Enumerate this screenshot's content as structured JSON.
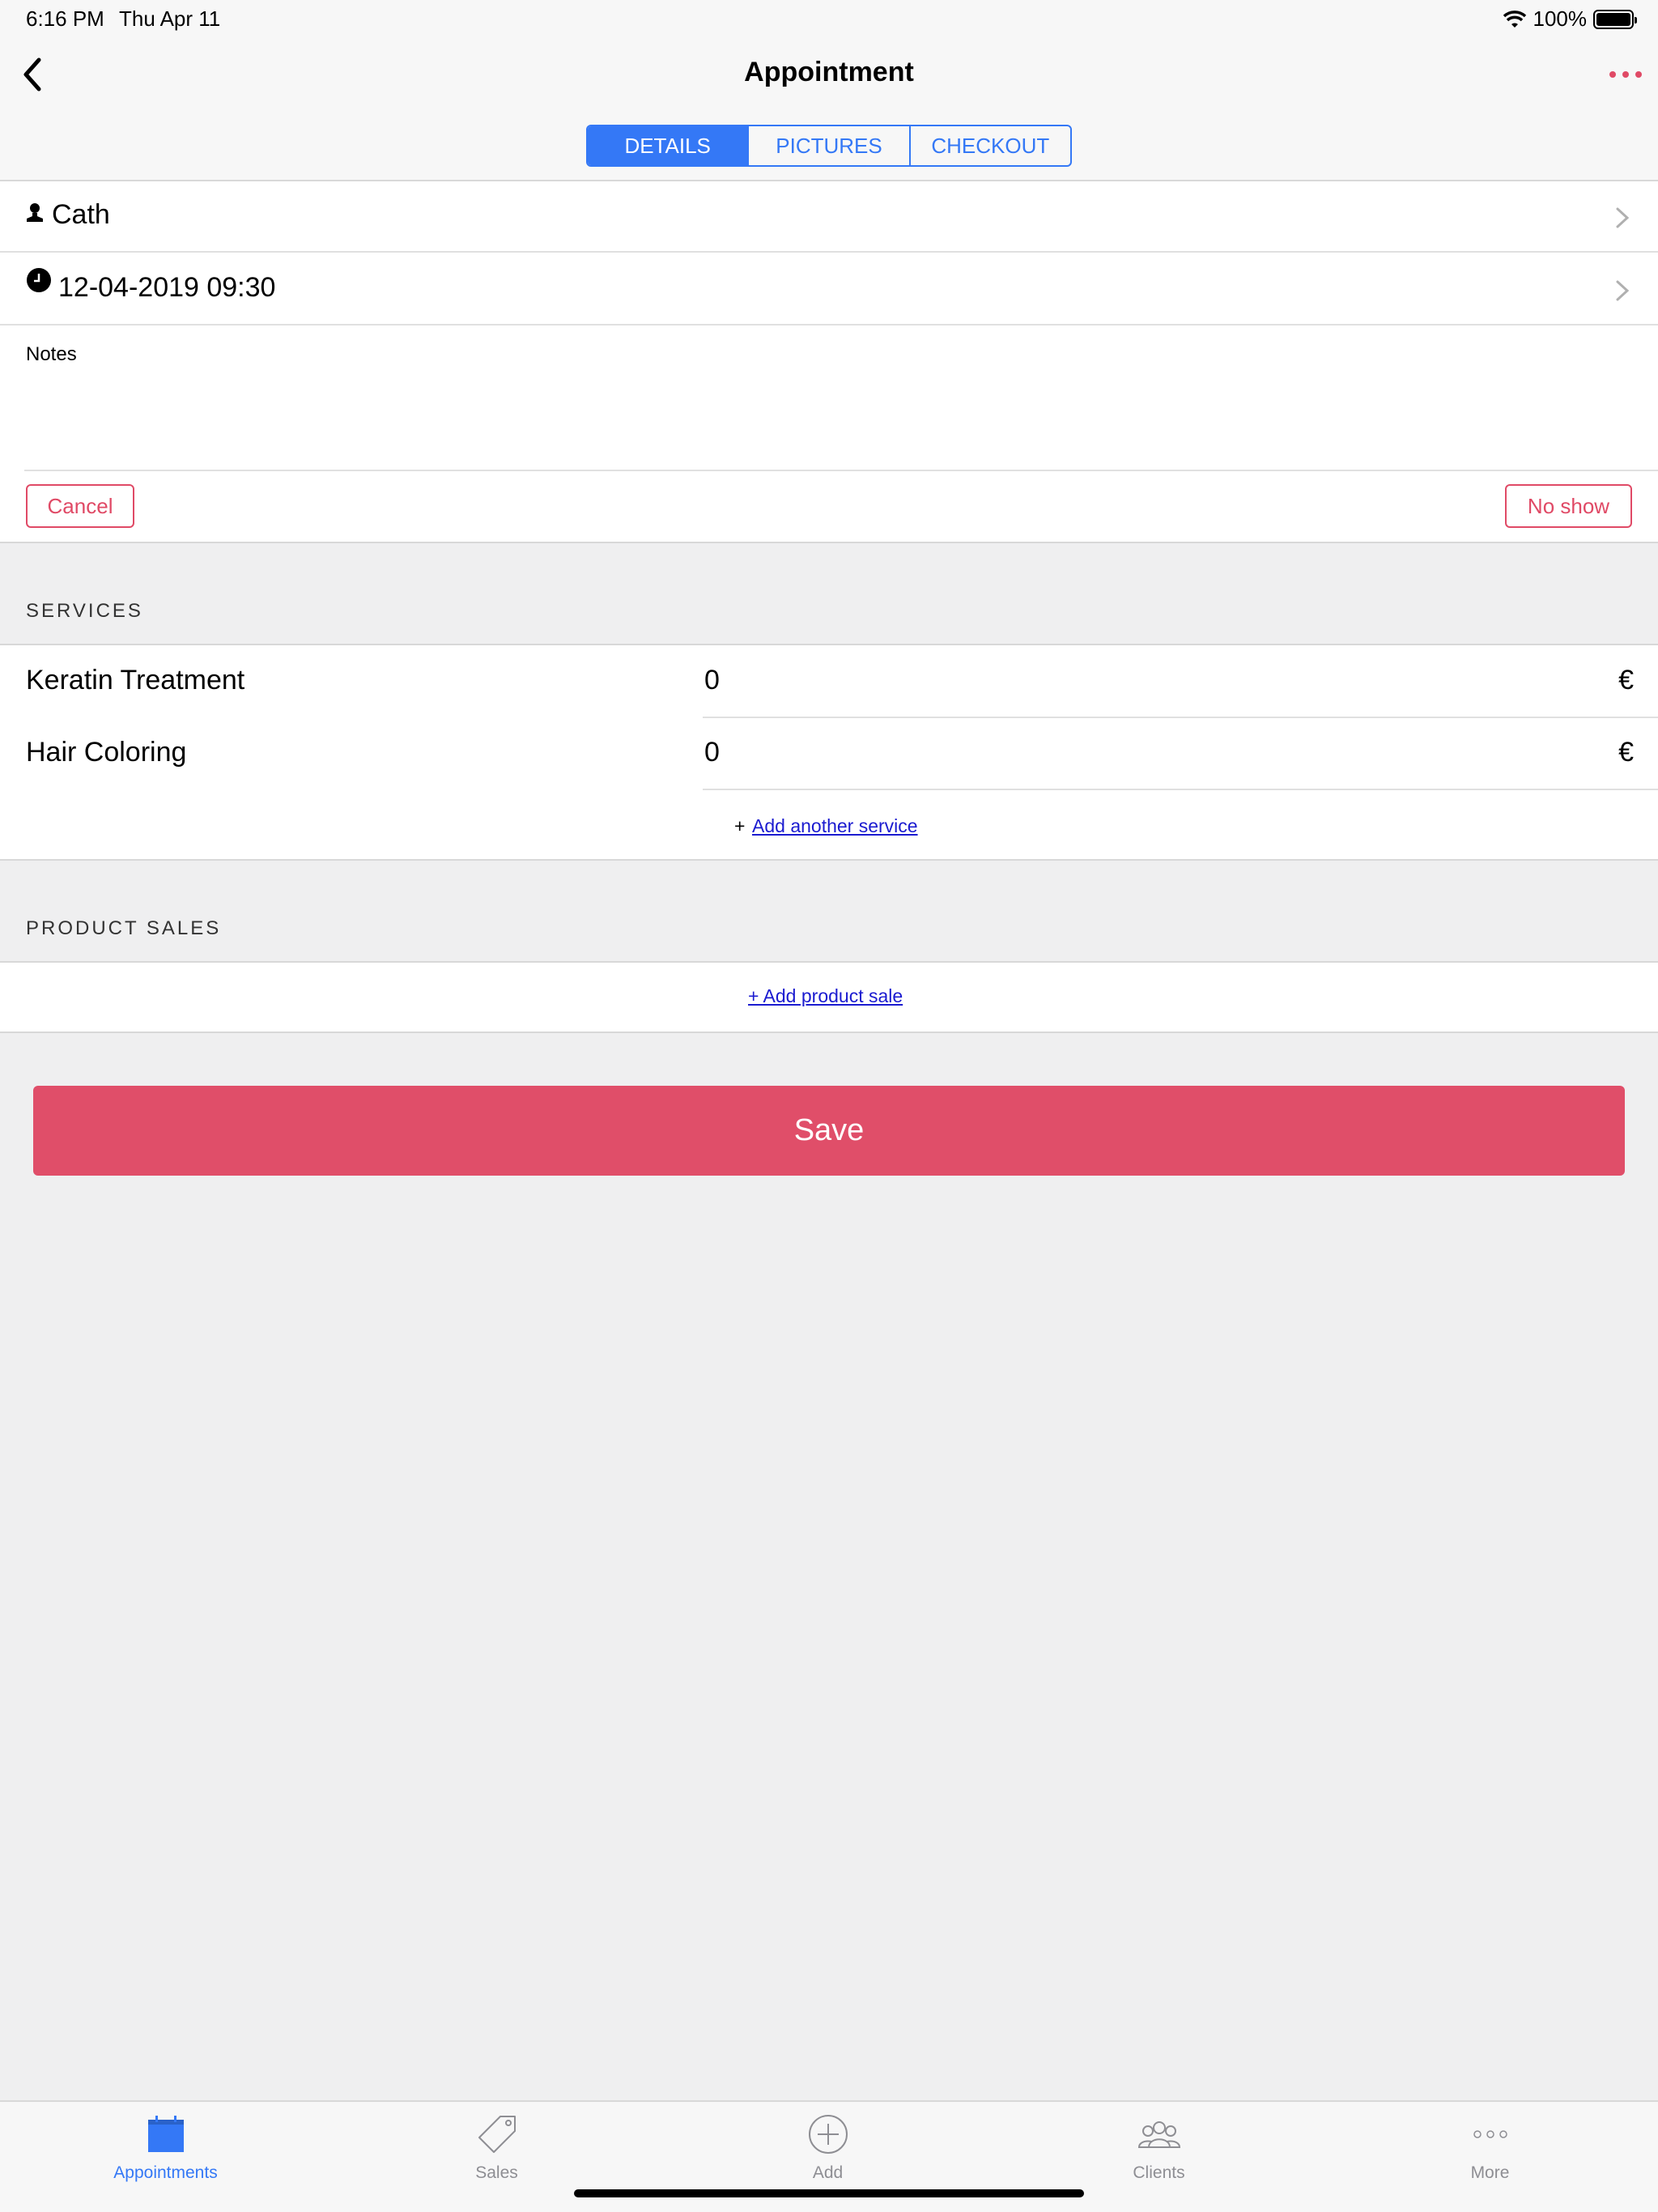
{
  "status_bar": {
    "time": "6:16 PM",
    "date": "Thu Apr 11",
    "battery": "100%"
  },
  "nav": {
    "title": "Appointment",
    "back_icon": "chevron-left-icon",
    "more_icon": "ellipsis-icon"
  },
  "tabs": [
    {
      "label": "DETAILS",
      "active": true
    },
    {
      "label": "PICTURES",
      "active": false
    },
    {
      "label": "CHECKOUT",
      "active": false
    }
  ],
  "details": {
    "client": "Cath",
    "datetime": "12-04-2019 09:30",
    "notes_label": "Notes",
    "cancel_label": "Cancel",
    "no_show_label": "No show"
  },
  "services": {
    "header": "SERVICES",
    "items": [
      {
        "name": "Keratin Treatment",
        "price": "0",
        "currency": "€"
      },
      {
        "name": "Hair Coloring",
        "price": "0",
        "currency": "€"
      }
    ],
    "add_plus": "+",
    "add_label": "Add another service"
  },
  "products": {
    "header": "PRODUCT SALES",
    "add_label": "+ Add product sale"
  },
  "save_label": "Save",
  "tabbar": [
    {
      "label": "Appointments",
      "icon": "calendar-icon",
      "active": true
    },
    {
      "label": "Sales",
      "icon": "tag-icon",
      "active": false
    },
    {
      "label": "Add",
      "icon": "plus-circle-icon",
      "active": false
    },
    {
      "label": "Clients",
      "icon": "people-icon",
      "active": false
    },
    {
      "label": "More",
      "icon": "ellipsis-icon",
      "active": false
    }
  ],
  "colors": {
    "accent": "#3478f6",
    "danger": "#e04a66",
    "save": "#e04e69"
  }
}
